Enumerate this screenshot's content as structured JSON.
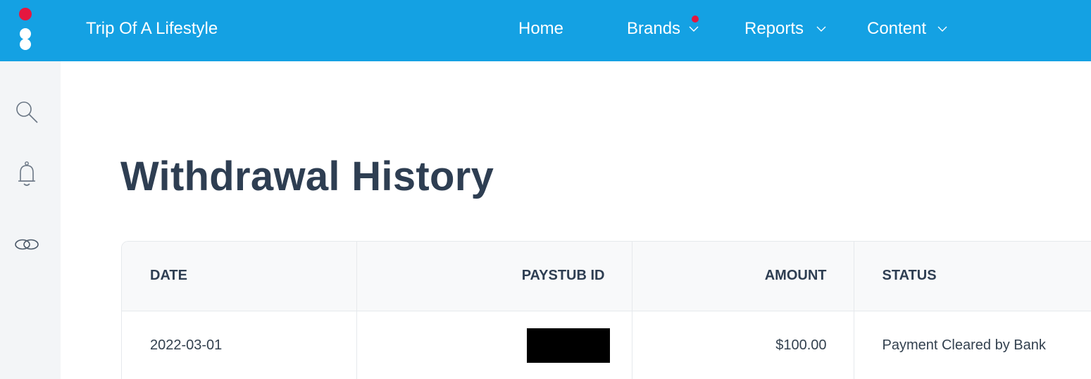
{
  "app": {
    "name": "Trip Of A Lifestyle",
    "accent_color": "#14a1e3",
    "logo_dot_color": "#e5173f"
  },
  "nav": {
    "items": [
      {
        "label": "Home",
        "has_dropdown": false
      },
      {
        "label": "Brands",
        "has_dropdown": true,
        "has_notification": true
      },
      {
        "label": "Reports",
        "has_dropdown": true
      },
      {
        "label": "Content",
        "has_dropdown": true
      }
    ]
  },
  "sidebar": {
    "icons": [
      "search-icon",
      "bell-icon",
      "link-icon"
    ]
  },
  "page": {
    "title": "Withdrawal History"
  },
  "table": {
    "columns": [
      "DATE",
      "PAYSTUB ID",
      "AMOUNT",
      "STATUS"
    ],
    "rows": [
      {
        "date": "2022-03-01",
        "paystub_id": "",
        "paystub_redacted": true,
        "amount": "$100.00",
        "status": "Payment Cleared by Bank"
      }
    ]
  }
}
